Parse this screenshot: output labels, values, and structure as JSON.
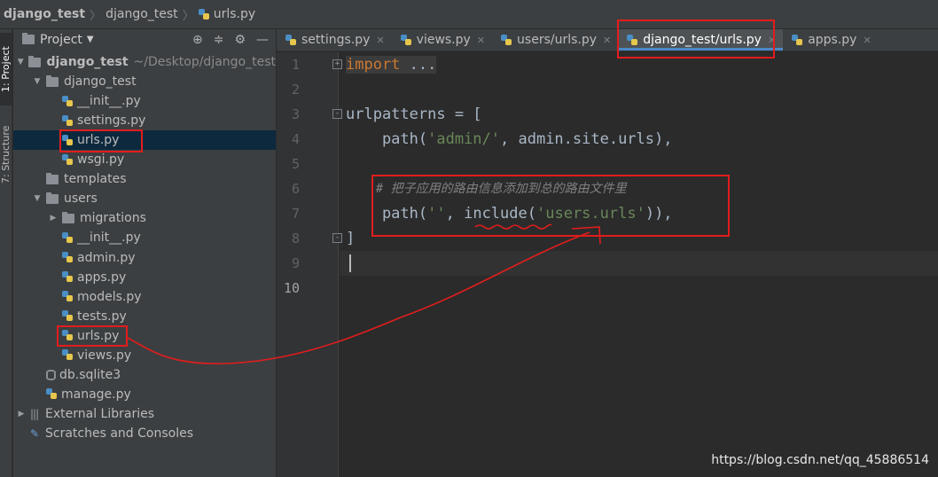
{
  "breadcrumb": {
    "project": "django_test",
    "folder": "django_test",
    "file": "urls.py"
  },
  "tool_strip": {
    "project_label": "1: Project",
    "structure_label": "7: Structure"
  },
  "project_panel": {
    "title": "Project",
    "tree": [
      {
        "label": "django_test",
        "extra": "~/Desktop/django_test",
        "type": "folder",
        "depth": 0,
        "expanded": true,
        "bold": true
      },
      {
        "label": "django_test",
        "type": "folder",
        "depth": 1,
        "expanded": true
      },
      {
        "label": "__init__.py",
        "type": "py",
        "depth": 2
      },
      {
        "label": "settings.py",
        "type": "py",
        "depth": 2
      },
      {
        "label": "urls.py",
        "type": "py",
        "depth": 2,
        "selected": true
      },
      {
        "label": "wsgi.py",
        "type": "py",
        "depth": 2
      },
      {
        "label": "templates",
        "type": "folder",
        "depth": 1
      },
      {
        "label": "users",
        "type": "folder",
        "depth": 1,
        "expanded": true
      },
      {
        "label": "migrations",
        "type": "folder",
        "depth": 2,
        "collapsed": true
      },
      {
        "label": "__init__.py",
        "type": "py",
        "depth": 2
      },
      {
        "label": "admin.py",
        "type": "py",
        "depth": 2
      },
      {
        "label": "apps.py",
        "type": "py",
        "depth": 2
      },
      {
        "label": "models.py",
        "type": "py",
        "depth": 2
      },
      {
        "label": "tests.py",
        "type": "py",
        "depth": 2
      },
      {
        "label": "urls.py",
        "type": "py",
        "depth": 2
      },
      {
        "label": "views.py",
        "type": "py",
        "depth": 2
      },
      {
        "label": "db.sqlite3",
        "type": "db",
        "depth": 1
      },
      {
        "label": "manage.py",
        "type": "py",
        "depth": 1
      },
      {
        "label": "External Libraries",
        "type": "lib",
        "depth": 0,
        "collapsed": true
      },
      {
        "label": "Scratches and Consoles",
        "type": "scratch",
        "depth": 0
      }
    ]
  },
  "tabs": [
    {
      "label": "settings.py",
      "active": false
    },
    {
      "label": "views.py",
      "active": false
    },
    {
      "label": "users/urls.py",
      "active": false
    },
    {
      "label": "django_test/urls.py",
      "active": true
    },
    {
      "label": "apps.py",
      "active": false
    }
  ],
  "editor": {
    "line_numbers": [
      "1",
      "2",
      "3",
      "4",
      "5",
      "6",
      "7",
      "8",
      "9",
      "10"
    ],
    "code": {
      "l1_kw": "import",
      "l1_rest": " ...",
      "l4_name": "urlpatterns",
      "l4_rest": " = [",
      "l5_a": "    path(",
      "l5_str": "'admin/'",
      "l5_b": ", admin.site.urls),",
      "l7_comment": "    # 把子应用的路由信息添加到总的路由文件里",
      "l8_a": "    path(",
      "l8_str1": "''",
      "l8_b": ", ",
      "l8_include": "include",
      "l8_c": "(",
      "l8_str2": "'users.urls'",
      "l8_d": ")),",
      "l9": "]"
    }
  },
  "watermark": "https://blog.csdn.net/qq_45886514",
  "colors": {
    "annotation": "#e11d1d",
    "keyword": "#cc7832",
    "string": "#6a8759",
    "comment": "#808080",
    "selection": "#0d293e",
    "tab_underline": "#4a88c7"
  }
}
